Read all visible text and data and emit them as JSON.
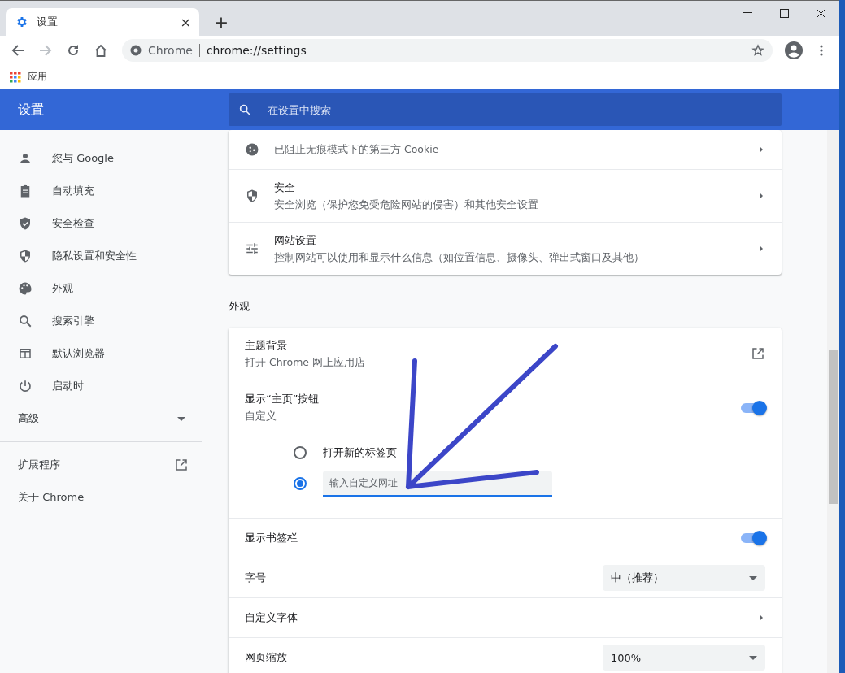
{
  "tab": {
    "title": "设置",
    "close": "×",
    "new_tab": "+"
  },
  "omnibox": {
    "site": "Chrome",
    "url": "chrome://settings"
  },
  "bookmarks": [
    {
      "label": "应用"
    }
  ],
  "header": {
    "title": "设置",
    "search_placeholder": "在设置中搜索"
  },
  "sidebar": {
    "items": [
      {
        "label": "您与 Google"
      },
      {
        "label": "自动填充"
      },
      {
        "label": "安全检查"
      },
      {
        "label": "隐私设置和安全性"
      },
      {
        "label": "外观"
      },
      {
        "label": "搜索引擎"
      },
      {
        "label": "默认浏览器"
      },
      {
        "label": "启动时"
      }
    ],
    "advanced": {
      "label": "高级",
      "expanded": false
    },
    "links": [
      {
        "label": "扩展程序",
        "external": true
      },
      {
        "label": "关于 Chrome",
        "external": false
      }
    ]
  },
  "privacy_card": {
    "rows": [
      {
        "subtitle": "已阻止无痕模式下的第三方 Cookie"
      },
      {
        "title": "安全",
        "subtitle": "安全浏览（保护您免受危险网站的侵害）和其他安全设置"
      },
      {
        "title": "网站设置",
        "subtitle": "控制网站可以使用和显示什么信息（如位置信息、摄像头、弹出式窗口及其他）"
      }
    ]
  },
  "appearance": {
    "heading": "外观",
    "rows": [
      {
        "kind": "external",
        "title": "主题背景",
        "subtitle": "打开 Chrome 网上应用店"
      },
      {
        "kind": "toggle",
        "title": "显示“主页”按钮",
        "subtitle": "自定义",
        "on": true,
        "options": [
          {
            "kind": "radio",
            "label": "打开新的标签页",
            "selected": false
          },
          {
            "kind": "field",
            "placeholder": "输入自定义网址",
            "selected": true
          }
        ]
      },
      {
        "kind": "toggle",
        "title": "显示书签栏",
        "on": true
      },
      {
        "kind": "select",
        "title": "字号",
        "value": "中（推荐）"
      },
      {
        "kind": "link",
        "title": "自定义字体"
      },
      {
        "kind": "select",
        "title": "网页缩放",
        "value": "100%"
      }
    ]
  }
}
